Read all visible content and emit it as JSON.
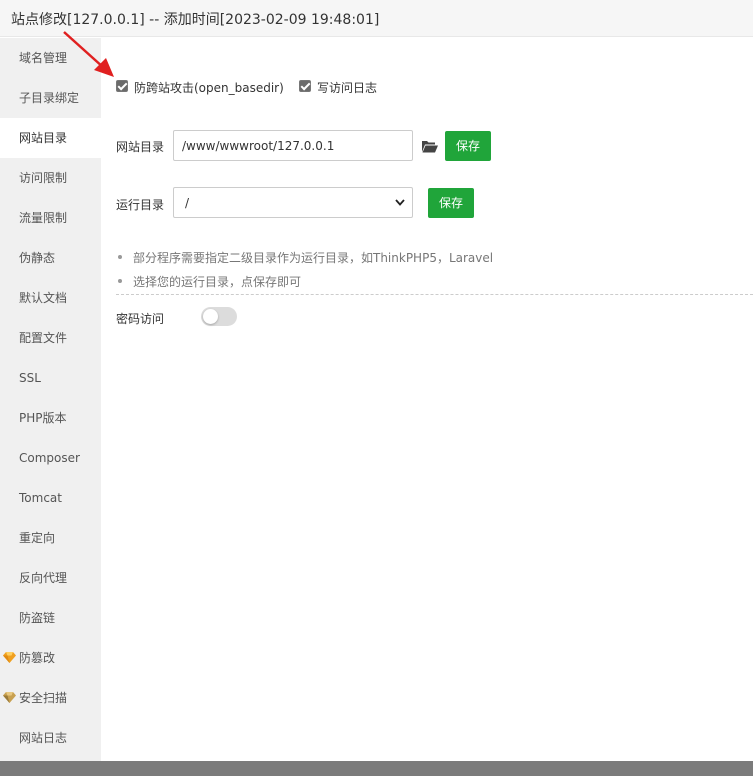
{
  "title": "站点修改[127.0.0.1] -- 添加时间[2023-02-09 19:48:01]",
  "sidebar": {
    "items": [
      {
        "label": "域名管理"
      },
      {
        "label": "子目录绑定"
      },
      {
        "label": "网站目录",
        "active": true
      },
      {
        "label": "访问限制"
      },
      {
        "label": "流量限制"
      },
      {
        "label": "伪静态"
      },
      {
        "label": "默认文档"
      },
      {
        "label": "配置文件"
      },
      {
        "label": "SSL"
      },
      {
        "label": "PHP版本"
      },
      {
        "label": "Composer"
      },
      {
        "label": "Tomcat"
      },
      {
        "label": "重定向"
      },
      {
        "label": "反向代理"
      },
      {
        "label": "防盗链"
      },
      {
        "label": "防篡改",
        "icon": "gem-icon"
      },
      {
        "label": "安全扫描",
        "icon": "gem-icon"
      },
      {
        "label": "网站日志"
      }
    ]
  },
  "options": {
    "anti_xss_label": "防跨站攻击(open_basedir)",
    "anti_xss_checked": true,
    "access_log_label": "写访问日志",
    "access_log_checked": true
  },
  "site_dir": {
    "label": "网站目录",
    "value": "/www/wwwroot/127.0.0.1",
    "save_label": "保存"
  },
  "run_dir": {
    "label": "运行目录",
    "selected": "/",
    "save_label": "保存"
  },
  "tips": [
    "部分程序需要指定二级目录作为运行目录，如ThinkPHP5，Laravel",
    "选择您的运行目录，点保存即可"
  ],
  "password_access": {
    "label": "密码访问",
    "enabled": false
  },
  "colors": {
    "accent": "#20a53a",
    "arrow": "#e02020",
    "gem": "#f0a020"
  }
}
